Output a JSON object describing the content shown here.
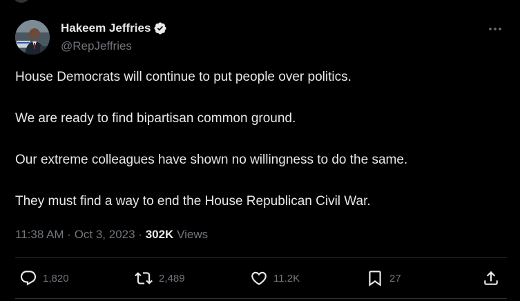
{
  "author": {
    "display_name": "Hakeem Jeffries",
    "handle": "@RepJeffries",
    "avatar_icon": "profile-photo",
    "verified_icon": "verified-badge-icon",
    "verified_color": "#1d9bf0"
  },
  "tweet": {
    "lines": [
      "House Democrats will continue to put people over politics.",
      "We are ready to find bipartisan common ground.",
      "Our extreme colleagues have shown no willingness to do the same.",
      "They must find a way to end the House Republican Civil War."
    ],
    "time": "11:38 AM",
    "date": "Oct 3, 2023",
    "views_count": "302K",
    "views_label": "Views"
  },
  "actions": {
    "replies": "1,820",
    "reposts": "2,489",
    "likes": "11.2K",
    "bookmarks": "27"
  },
  "colors": {
    "background": "#000000",
    "text": "#e7e9ea",
    "secondary": "#71767b",
    "divider": "#2f3336"
  }
}
